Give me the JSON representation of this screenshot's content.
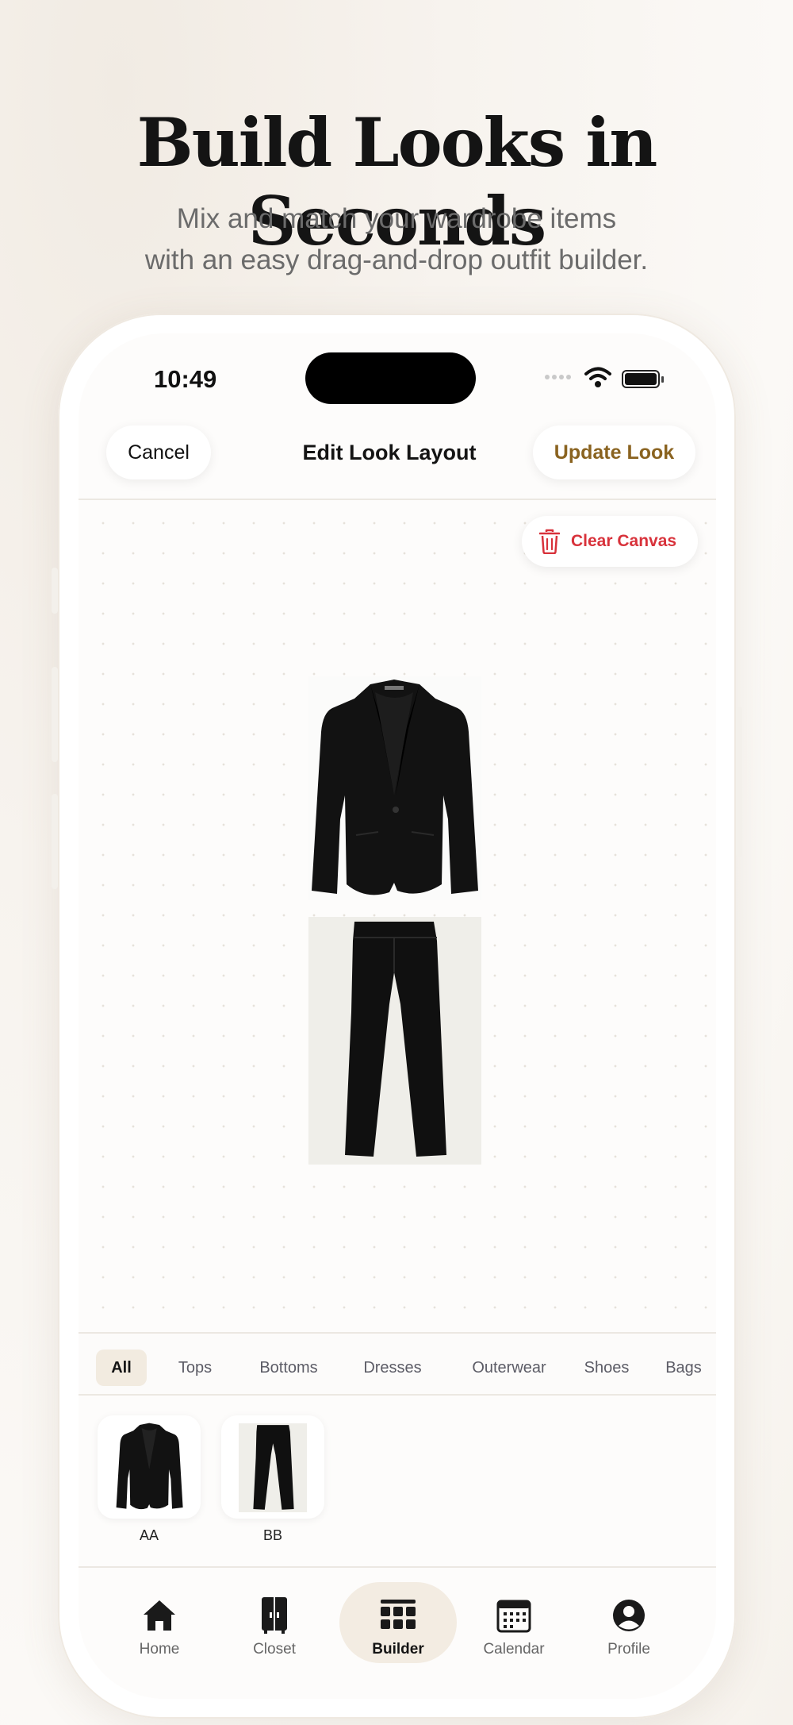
{
  "marketing": {
    "headline": "Build Looks in Seconds",
    "subline_1": "Mix and match your wardrobe items",
    "subline_2": "with an easy drag-and-drop outfit builder."
  },
  "status_bar": {
    "time": "10:49",
    "icons": [
      "signal-dots-icon",
      "wifi-icon",
      "battery-icon"
    ]
  },
  "nav": {
    "cancel_label": "Cancel",
    "title": "Edit Look Layout",
    "update_label": "Update Look"
  },
  "canvas": {
    "clear_label": "Clear Canvas",
    "items": [
      {
        "name": "black-blazer",
        "icon": "blazer-image"
      },
      {
        "name": "black-trousers",
        "icon": "trousers-image"
      }
    ]
  },
  "categories": {
    "all": "All",
    "tops": "Tops",
    "bottoms": "Bottoms",
    "dresses": "Dresses",
    "outerwear": "Outerwear",
    "shoes": "Shoes",
    "bags": "Bags",
    "selected": "All"
  },
  "wardrobe_items": [
    {
      "label": "AA",
      "icon": "blazer-image"
    },
    {
      "label": "BB",
      "icon": "trousers-image"
    }
  ],
  "tabs": {
    "home": "Home",
    "closet": "Closet",
    "builder": "Builder",
    "calendar": "Calendar",
    "profile": "Profile",
    "active": "Builder"
  },
  "colors": {
    "accent_gold": "#8a6320",
    "danger_red": "#d8323b",
    "active_bg": "#f3ece2"
  }
}
